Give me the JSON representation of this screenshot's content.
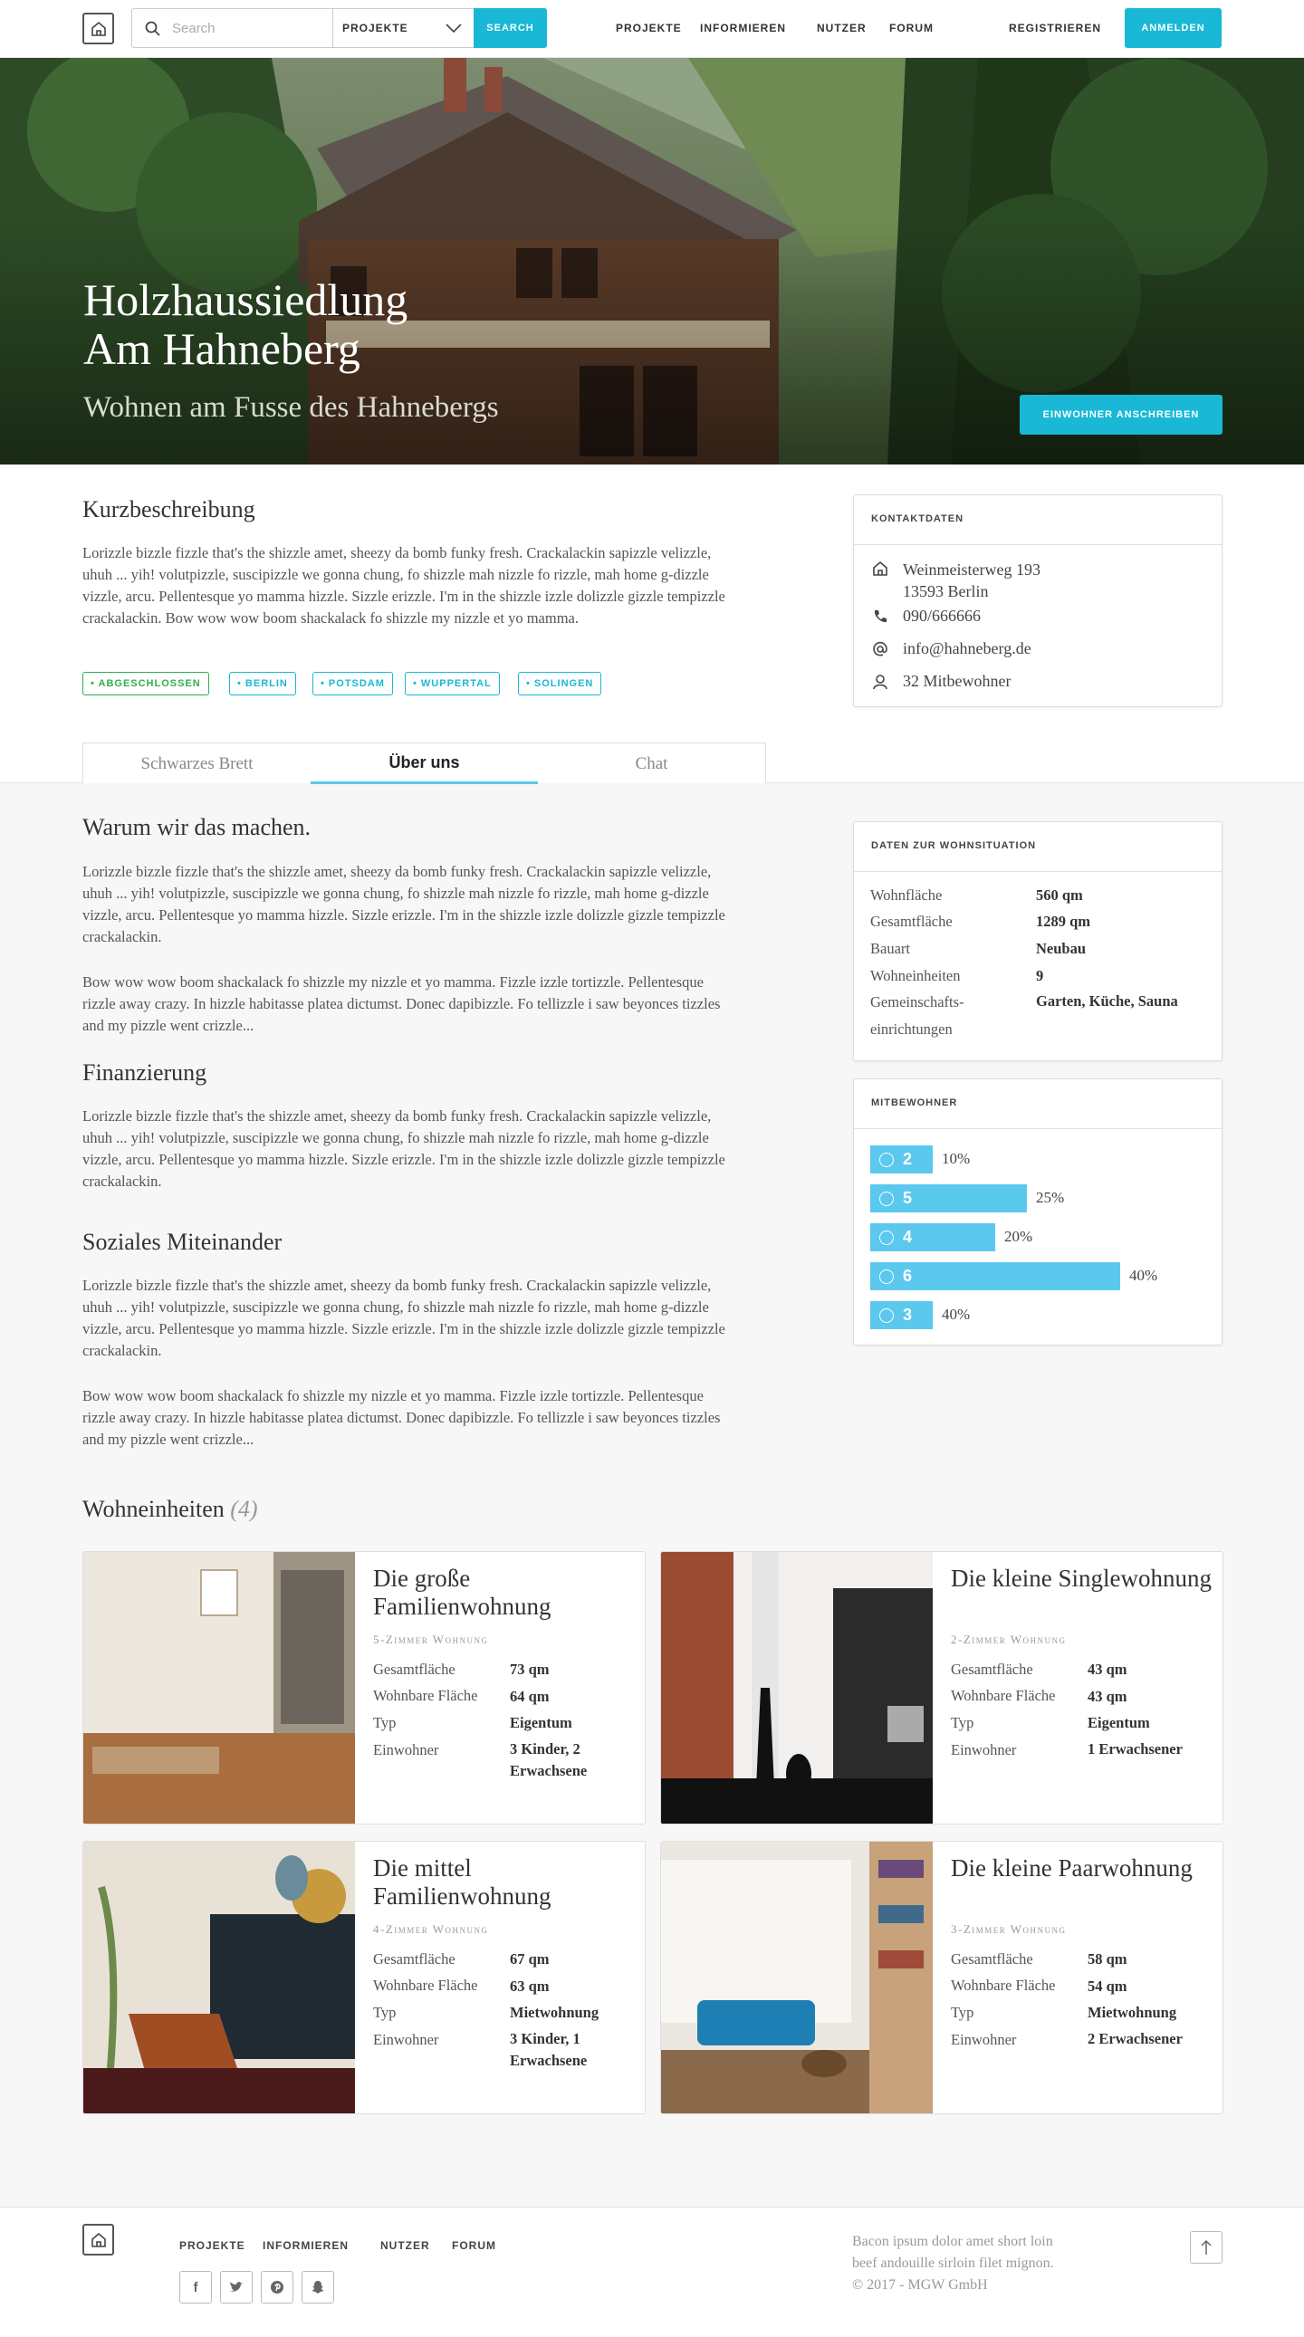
{
  "header": {
    "search_placeholder": "Search",
    "search_scope": "PROJEKTE",
    "search_button": "SEARCH",
    "nav": [
      "PROJEKTE",
      "INFORMIEREN",
      "NUTZER",
      "FORUM"
    ],
    "register": "REGISTRIEREN",
    "login": "ANMELDEN"
  },
  "hero": {
    "title_line1": "Holzhaussiedlung",
    "title_line2": "Am Hahneberg",
    "subtitle": "Wohnen am Fusse des Hahnebergs",
    "contact_button": "EINWOHNER ANSCHREIBEN"
  },
  "intro": {
    "title": "Kurzbeschreibung",
    "text": "Lorizzle bizzle fizzle that's the shizzle amet, sheezy da bomb funky fresh. Crackalackin sapizzle velizzle, uhuh ... yih! volutpizzle, suscipizzle we gonna chung, fo shizzle mah nizzle fo rizzle, mah home g-dizzle vizzle, arcu. Pellentesque yo mamma hizzle. Sizzle erizzle. I'm in the shizzle izzle dolizzle gizzle tempizzle crackalackin. Bow wow wow boom shackalack fo shizzle my nizzle et yo mamma.",
    "tags": [
      "• ABGESCHLOSSEN",
      "• BERLIN",
      "• POTSDAM",
      "• WUPPERTAL",
      "• SOLINGEN"
    ]
  },
  "contact": {
    "title": "KONTAKTDATEN",
    "street": "Weinmeisterweg 193",
    "city": "13593 Berlin",
    "phone": "090/666666",
    "email": "info@hahneberg.de",
    "members": "32 Mitbewohner"
  },
  "tabs": [
    "Schwarzes Brett",
    "Über uns",
    "Chat"
  ],
  "about": {
    "why_title": "Warum wir das machen.",
    "why_p1": "Lorizzle bizzle fizzle that's the shizzle amet, sheezy da bomb funky fresh. Crackalackin sapizzle velizzle, uhuh ... yih! volutpizzle, suscipizzle we gonna chung, fo shizzle mah nizzle fo rizzle, mah home g-dizzle vizzle, arcu. Pellentesque yo mamma hizzle. Sizzle erizzle. I'm in the shizzle izzle dolizzle gizzle tempizzle crackalackin.",
    "why_p2": "Bow wow wow boom shackalack fo shizzle my nizzle et yo mamma. Fizzle izzle tortizzle. Pellentesque rizzle away crazy. In hizzle habitasse platea dictumst. Donec dapibizzle. Fo tellizzle i saw beyonces tizzles and my pizzle went crizzle...",
    "fin_title": "Finanzierung",
    "fin_p1": "Lorizzle bizzle fizzle that's the shizzle amet, sheezy da bomb funky fresh. Crackalackin sapizzle velizzle, uhuh ... yih! volutpizzle, suscipizzle we gonna chung, fo shizzle mah nizzle fo rizzle, mah home g-dizzle vizzle, arcu. Pellentesque yo mamma hizzle. Sizzle erizzle. I'm in the shizzle izzle dolizzle gizzle tempizzle crackalackin.",
    "soc_title": "Soziales Miteinander",
    "soc_p1": "Lorizzle bizzle fizzle that's the shizzle amet, sheezy da bomb funky fresh. Crackalackin sapizzle velizzle, uhuh ... yih! volutpizzle, suscipizzle we gonna chung, fo shizzle mah nizzle fo rizzle, mah home g-dizzle vizzle, arcu. Pellentesque yo mamma hizzle. Sizzle erizzle. I'm in the shizzle izzle dolizzle gizzle tempizzle crackalackin.",
    "soc_p2": "Bow wow wow boom shackalack fo shizzle my nizzle et yo mamma. Fizzle izzle tortizzle. Pellentesque rizzle away crazy. In hizzle habitasse platea dictumst. Donec dapibizzle. Fo tellizzle i saw beyonces tizzles and my pizzle went crizzle..."
  },
  "housing": {
    "title": "DATEN ZUR WOHNSITUATION",
    "rows": [
      {
        "label": "Wohnfläche",
        "value": "560 qm"
      },
      {
        "label": "Gesamtfläche",
        "value": "1289 qm"
      },
      {
        "label": "Bauart",
        "value": "Neubau"
      },
      {
        "label": "Wohneinheiten",
        "value": "9"
      },
      {
        "label": "Gemeinschafts-",
        "label2": "einrichtungen",
        "value": "Garten, Küche, Sauna"
      }
    ]
  },
  "residents": {
    "title": "MITBEWOHNER",
    "bars": [
      {
        "count": "2",
        "percent": "10%",
        "share": 0.1
      },
      {
        "count": "5",
        "percent": "25%",
        "share": 0.25
      },
      {
        "count": "4",
        "percent": "20%",
        "share": 0.2
      },
      {
        "count": "6",
        "percent": "40%",
        "share": 0.4
      },
      {
        "count": "3",
        "percent": "40%",
        "share": 0.1
      }
    ]
  },
  "units": {
    "title": "Wohneinheiten",
    "count": "(4)",
    "labels": {
      "total": "Gesamtfläche",
      "living": "Wohnbare Fläche",
      "type": "Typ",
      "residents": "Einwohner"
    },
    "items": [
      {
        "title": "Die große Familienwohnung",
        "subtitle": "5-Zimmer Wohnung",
        "total": "73 qm",
        "living": "64 qm",
        "type": "Eigentum",
        "residents": "3 Kinder, 2 Erwachsene"
      },
      {
        "title": "Die kleine Singlewohnung",
        "subtitle": "2-Zimmer Wohnung",
        "total": "43 qm",
        "living": "43 qm",
        "type": "Eigentum",
        "residents": "1 Erwachsener"
      },
      {
        "title": "Die mittel Familienwohnung",
        "subtitle": "4-Zimmer Wohnung",
        "total": "67 qm",
        "living": "63 qm",
        "type": "Mietwohnung",
        "residents": "3 Kinder, 1 Erwachsene"
      },
      {
        "title": "Die kleine Paarwohnung",
        "subtitle": "3-Zimmer Wohnung",
        "total": "58 qm",
        "living": "54 qm",
        "type": "Mietwohnung",
        "residents": "2 Erwachsener"
      }
    ]
  },
  "footer": {
    "nav": [
      "PROJEKTE",
      "INFORMIEREN",
      "NUTZER",
      "FORUM"
    ],
    "text1": "Bacon ipsum dolor amet short loin",
    "text2": "beef andouille sirloin filet mignon.",
    "copyright": "© 2017 - MGW GmbH",
    "social": [
      "facebook-icon",
      "twitter-icon",
      "pinterest-icon",
      "snapchat-icon"
    ]
  },
  "colors": {
    "accent": "#19b8d6",
    "bar": "#5bc8ee",
    "tag_done": "#2fae4f"
  }
}
